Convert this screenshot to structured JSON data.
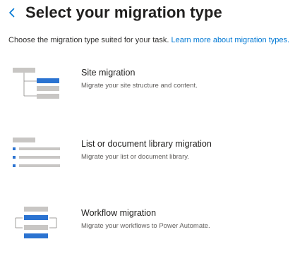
{
  "page": {
    "title": "Select your migration type",
    "subtitle": "Choose the migration type suited for your task.",
    "learn_more_link": "Learn more about migration types."
  },
  "options": [
    {
      "title": "Site migration",
      "description": "Migrate your site structure and content.",
      "icon": "site-tree-icon"
    },
    {
      "title": "List or document library migration",
      "description": "Migrate your list or document library.",
      "icon": "list-icon"
    },
    {
      "title": "Workflow migration",
      "description": "Migrate your workflows to Power Automate.",
      "icon": "workflow-icon"
    }
  ],
  "colors": {
    "accent": "#0078d4",
    "icon_gray": "#c8c6c4",
    "icon_blue": "#2b73d1"
  }
}
